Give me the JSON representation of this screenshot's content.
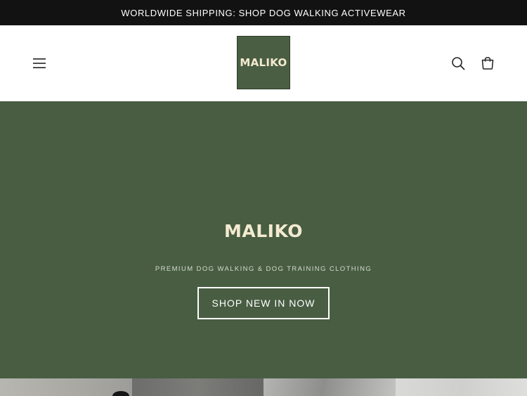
{
  "announcement": {
    "text": "WORLDWIDE SHIPPING: SHOP DOG WALKING ACTIVEWEAR"
  },
  "header": {
    "logo_text": "MALIKO",
    "icons": {
      "menu": "hamburger-menu-icon",
      "search": "search-icon",
      "cart": "cart-icon"
    }
  },
  "hero": {
    "title": "MALIKO",
    "subtitle": "PREMIUM DOG WALKING & DOG TRAINING CLOTHING",
    "cta_label": "SHOP NEW IN NOW"
  },
  "colors": {
    "brand_green": "#485d42",
    "logo_cream": "#f3ead0",
    "announcement_bg": "#121212"
  }
}
